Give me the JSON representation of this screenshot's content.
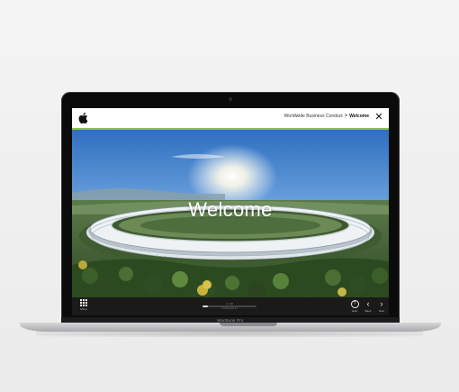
{
  "device": {
    "brand_label": "MacBook Pro"
  },
  "header": {
    "breadcrumb_parent": "Worldwide Business Conduct",
    "breadcrumb_separator": ">",
    "breadcrumb_current": "Welcome",
    "close_symbol": "✕"
  },
  "hero": {
    "title": "Welcome"
  },
  "footer": {
    "menu_label": "Menu",
    "progress_text": "1 / 10",
    "progress_sub": "© 2019 Apple Inc.",
    "progress_fraction": 0.1,
    "help_label": "Help",
    "back_label": "Back",
    "next_label": "Next"
  },
  "icons": {
    "logo": "apple-logo",
    "close": "close-icon",
    "menu": "grid-menu-icon",
    "help": "help-icon",
    "back": "chevron-left-icon",
    "next": "chevron-right-icon"
  },
  "colors": {
    "accent_line": "#8bc34a",
    "topbar_bg": "#ffffff",
    "bottombar_bg": "#1a1a1a"
  }
}
